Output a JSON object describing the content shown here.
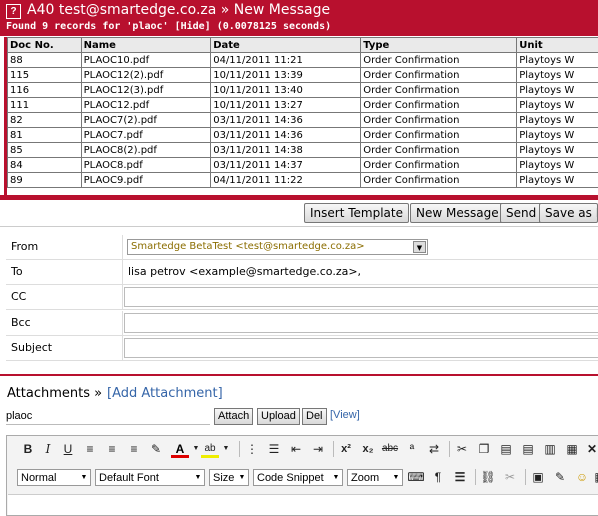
{
  "window": {
    "title": "A40 test@smartedge.co.za » New Message",
    "found_text": "Found 9 records for 'plaoc' [Hide] (0.0078125 seconds)"
  },
  "table": {
    "columns": [
      "Doc No.",
      "Name",
      "Date",
      "Type",
      "Unit"
    ],
    "rows": [
      [
        "88",
        "PLAOC10.pdf",
        "04/11/2011 11:21",
        "Order Confirmation",
        "Playtoys W"
      ],
      [
        "115",
        "PLAOC12(2).pdf",
        "10/11/2011 13:39",
        "Order Confirmation",
        "Playtoys W"
      ],
      [
        "116",
        "PLAOC12(3).pdf",
        "10/11/2011 13:40",
        "Order Confirmation",
        "Playtoys W"
      ],
      [
        "111",
        "PLAOC12.pdf",
        "10/11/2011 13:27",
        "Order Confirmation",
        "Playtoys W"
      ],
      [
        "82",
        "PLAOC7(2).pdf",
        "03/11/2011 14:36",
        "Order Confirmation",
        "Playtoys W"
      ],
      [
        "81",
        "PLAOC7.pdf",
        "03/11/2011 14:36",
        "Order Confirmation",
        "Playtoys W"
      ],
      [
        "85",
        "PLAOC8(2).pdf",
        "03/11/2011 14:38",
        "Order Confirmation",
        "Playtoys W"
      ],
      [
        "84",
        "PLAOC8.pdf",
        "03/11/2011 14:37",
        "Order Confirmation",
        "Playtoys W"
      ],
      [
        "89",
        "PLAOC9.pdf",
        "04/11/2011 11:22",
        "Order Confirmation",
        "Playtoys W"
      ]
    ]
  },
  "toolbar": {
    "insert_template": "Insert Template",
    "new_message": "New Message",
    "send": "Send",
    "save_as": "Save as D"
  },
  "form": {
    "from_label": "From",
    "from_value": "Smartedge BetaTest <test@smartedge.co.za>",
    "to_label": "To",
    "to_value": "lisa petrov <example@smartedge.co.za>,",
    "cc_label": "CC",
    "bcc_label": "Bcc",
    "subject_label": "Subject"
  },
  "attachments": {
    "label": "Attachments »",
    "add_link": "[Add Attachment]",
    "search_value": "plaoc",
    "attach_btn": "Attach",
    "upload_btn": "Upload",
    "del_btn": "Del",
    "view_link": "[View]"
  },
  "editor": {
    "format_select": "Normal",
    "font_select": "Default Font",
    "size_select": "Size",
    "snippet_select": "Code Snippet",
    "zoom_select": "Zoom",
    "bold": "B",
    "italic": "I",
    "underline": "U",
    "font_color": "A",
    "highlight": "ab",
    "superscript": "x²",
    "subscript": "x₂",
    "strike": "abc"
  },
  "colors": {
    "brand": "#b8102e",
    "link": "#3565a8",
    "from_text": "#8b6d00"
  }
}
